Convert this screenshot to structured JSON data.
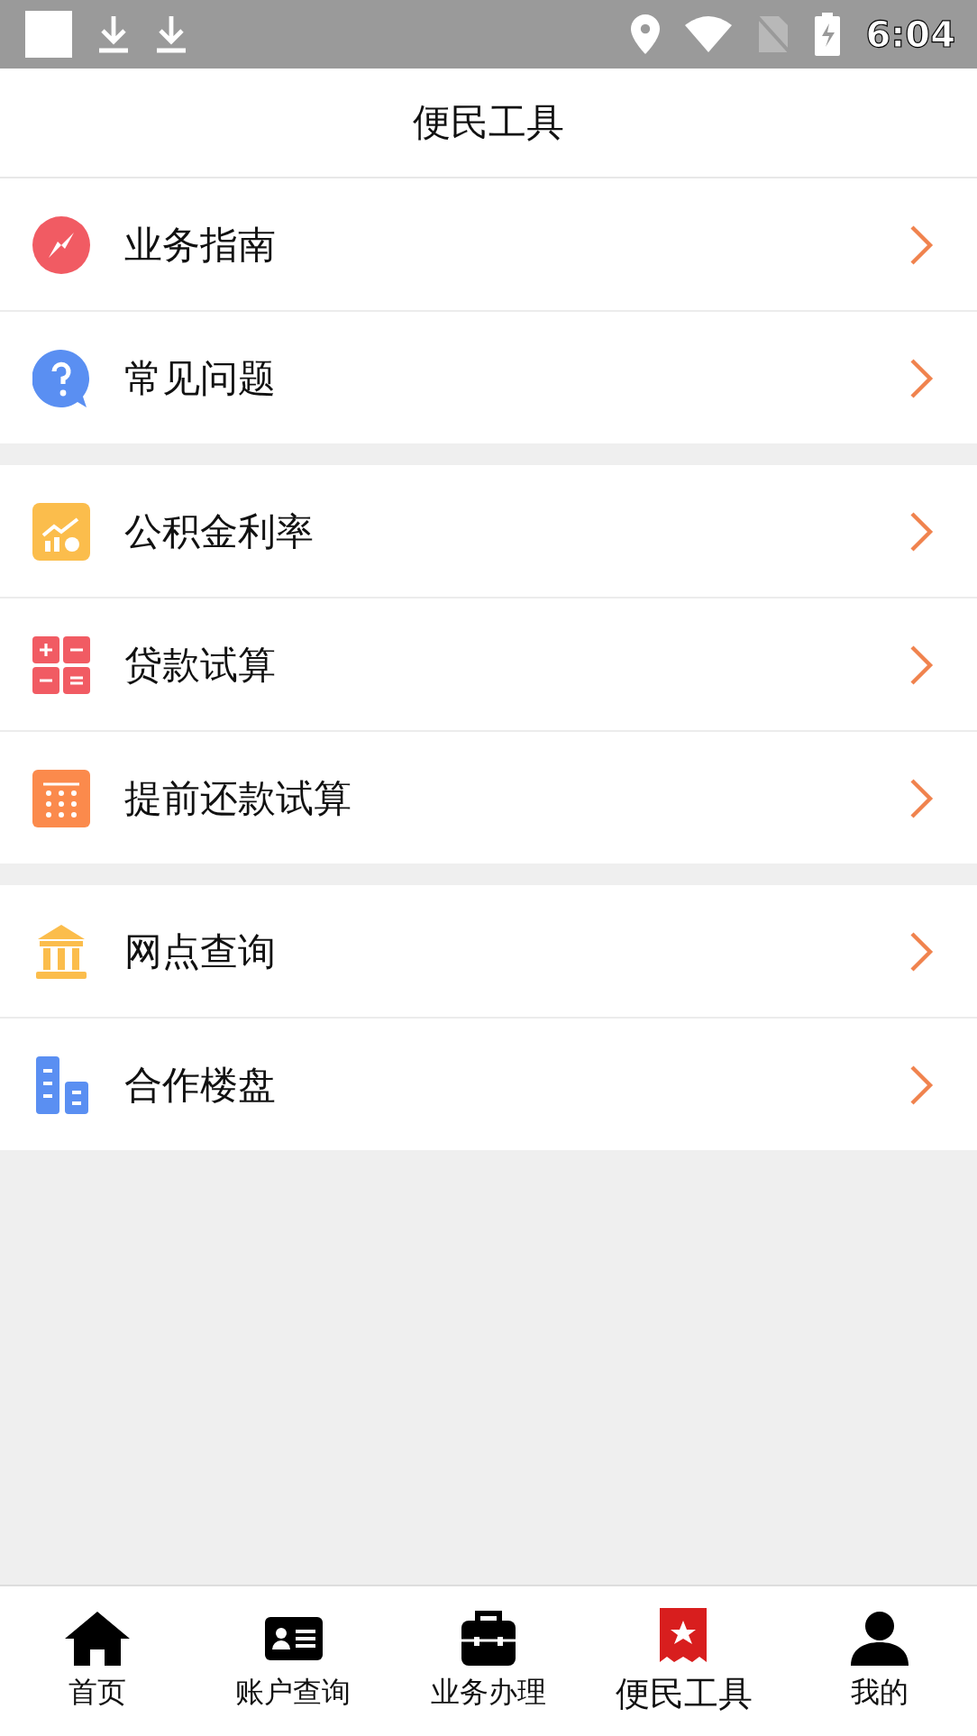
{
  "status_bar": {
    "time": "6:04"
  },
  "header": {
    "title": "便民工具"
  },
  "groups": [
    {
      "items": [
        {
          "label": "业务指南"
        },
        {
          "label": "常见问题"
        }
      ]
    },
    {
      "items": [
        {
          "label": "公积金利率"
        },
        {
          "label": "贷款试算"
        },
        {
          "label": "提前还款试算"
        }
      ]
    },
    {
      "items": [
        {
          "label": "网点查询"
        },
        {
          "label": "合作楼盘"
        }
      ]
    }
  ],
  "tab_bar": [
    {
      "label": "首页",
      "selected": false
    },
    {
      "label": "账户查询",
      "selected": false
    },
    {
      "label": "业务办理",
      "selected": false
    },
    {
      "label": "便民工具",
      "selected": true
    },
    {
      "label": "我的",
      "selected": false
    }
  ]
}
